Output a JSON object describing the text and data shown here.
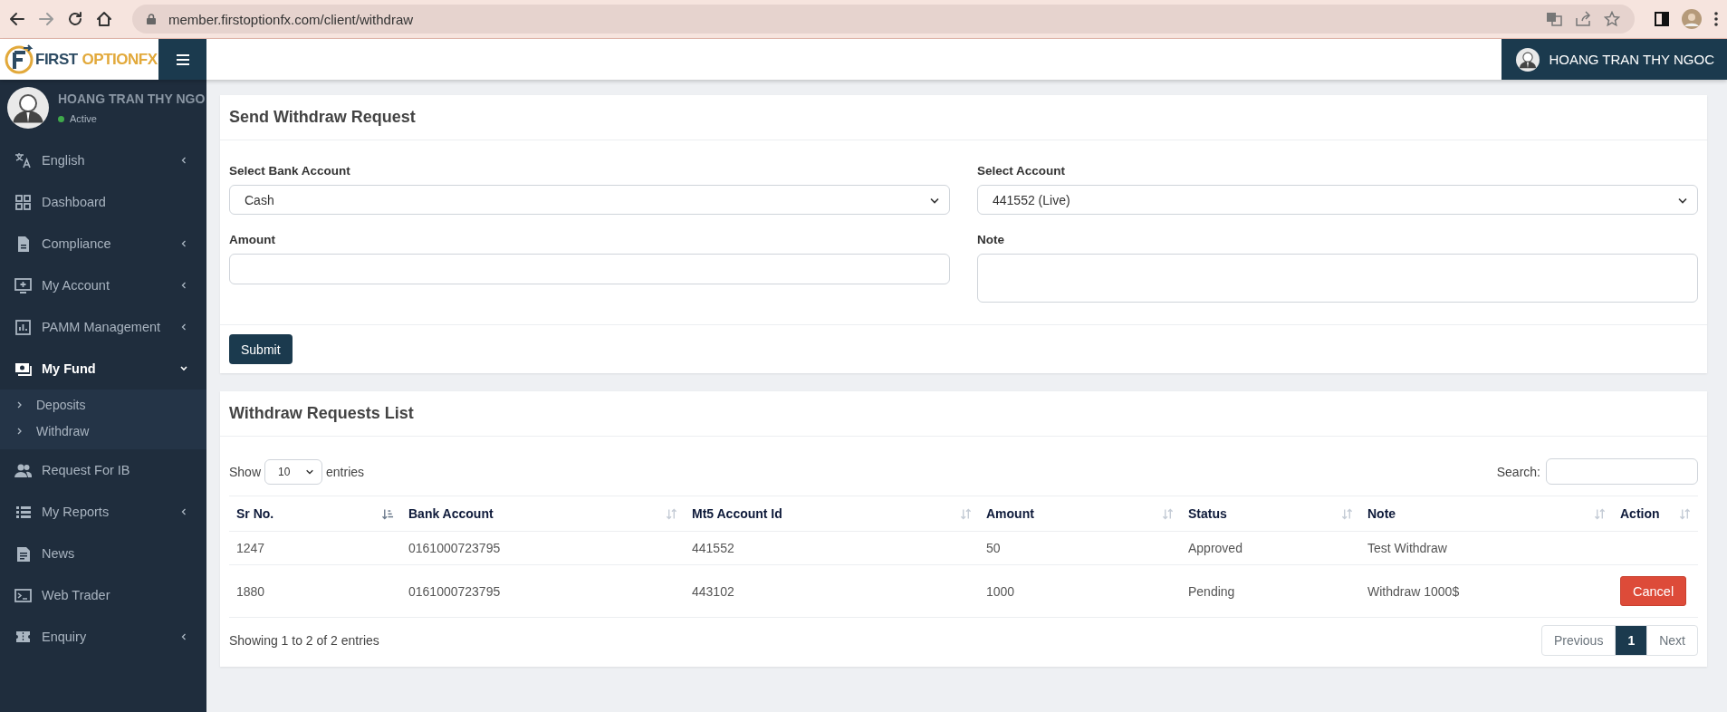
{
  "browser": {
    "url": "member.firstoptionfx.com/client/withdraw"
  },
  "brand": {
    "part_1": "FIRST",
    "part_2": "OPTIONFX"
  },
  "header": {
    "user_name": "HOANG TRAN THY NGOC"
  },
  "sidebar": {
    "user": {
      "name": "HOANG TRAN THY NGO",
      "status": "Active"
    },
    "items": [
      {
        "label": "English",
        "selected": false,
        "expanded": false
      },
      {
        "label": "Dashboard",
        "selected": false
      },
      {
        "label": "Compliance",
        "selected": false,
        "expanded": false
      },
      {
        "label": "My Account",
        "selected": false,
        "expanded": false
      },
      {
        "label": "PAMM Management",
        "selected": false,
        "expanded": false
      },
      {
        "label": "My Fund",
        "selected": true,
        "expanded": true,
        "children": [
          {
            "label": "Deposits",
            "selected": false
          },
          {
            "label": "Withdraw",
            "selected": false
          }
        ]
      },
      {
        "label": "Request For IB",
        "selected": false
      },
      {
        "label": "My Reports",
        "selected": false,
        "expanded": false
      },
      {
        "label": "News",
        "selected": false
      },
      {
        "label": "Web Trader",
        "selected": false
      },
      {
        "label": "Enquiry",
        "selected": false,
        "expanded": false
      }
    ]
  },
  "request_form": {
    "title": "Send Withdraw Request",
    "fields": [
      {
        "kind": "select",
        "label": "Select Bank Account",
        "value": "Cash"
      },
      {
        "kind": "select",
        "label": "Select Account",
        "value": "441552 (Live)"
      },
      {
        "kind": "input",
        "label": "Amount"
      },
      {
        "kind": "textarea",
        "label": "Note"
      }
    ],
    "submit": "Submit"
  },
  "requests_list": {
    "title": "Withdraw Requests List",
    "show_label": "Show",
    "page_length": "10",
    "entries_label": "entries",
    "search_label": "Search:",
    "columns": [
      {
        "label": "Sr No.",
        "sorted": true
      },
      {
        "label": "Bank Account",
        "sorted": false
      },
      {
        "label": "Mt5 Account Id",
        "sorted": false
      },
      {
        "label": "Amount",
        "sorted": false
      },
      {
        "label": "Status",
        "sorted": false
      },
      {
        "label": "Note",
        "sorted": false
      },
      {
        "label": "Action",
        "sorted": false
      }
    ],
    "rows": [
      {
        "cells": [
          "1247",
          "0161000723795",
          "441552",
          "50",
          "Approved",
          "Test Withdraw"
        ]
      },
      {
        "cells": [
          "1880",
          "0161000723795",
          "443102",
          "1000",
          "Pending",
          "Withdraw 1000$"
        ],
        "action": "Cancel"
      }
    ],
    "info": "Showing 1 to 2 of 2 entries",
    "pagination": [
      {
        "label": "Previous",
        "selected": false
      },
      {
        "label": "1",
        "selected": true
      },
      {
        "label": "Next",
        "selected": false
      }
    ]
  }
}
